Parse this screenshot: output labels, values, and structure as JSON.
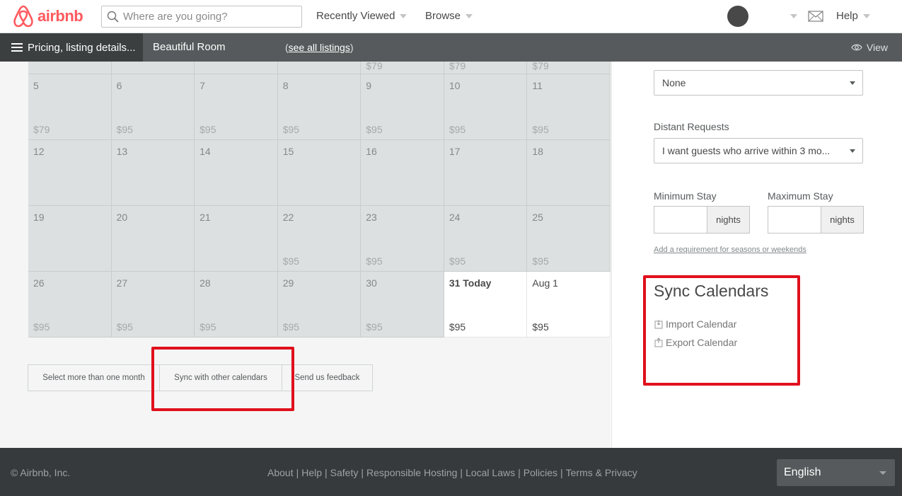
{
  "header": {
    "logo_text": "airbnb",
    "search_placeholder": "Where are you going?",
    "recently_viewed": "Recently Viewed",
    "browse": "Browse",
    "help": "Help"
  },
  "subnav": {
    "menu_label": "Pricing, listing details...",
    "listing_name": "Beautiful Room",
    "see_all_open": "(",
    "see_all": "see all listings",
    "see_all_close": ")",
    "view": "View"
  },
  "calendar": {
    "partial_row": [
      "",
      "",
      "",
      "",
      "$79",
      "$79",
      "$79"
    ],
    "weeks": [
      {
        "days": [
          "5",
          "6",
          "7",
          "8",
          "9",
          "10",
          "11"
        ],
        "prices": [
          "$79",
          "$95",
          "$95",
          "$95",
          "$95",
          "$95",
          "$95"
        ]
      },
      {
        "days": [
          "12",
          "13",
          "14",
          "15",
          "16",
          "17",
          "18"
        ],
        "prices": [
          "",
          "",
          "",
          "",
          "",
          "",
          ""
        ]
      },
      {
        "days": [
          "19",
          "20",
          "21",
          "22",
          "23",
          "24",
          "25"
        ],
        "prices": [
          "",
          "",
          "",
          "$95",
          "$95",
          "$95",
          "$95"
        ]
      },
      {
        "days": [
          "26",
          "27",
          "28",
          "29",
          "30",
          "31 Today",
          "Aug 1"
        ],
        "prices": [
          "$95",
          "$95",
          "$95",
          "$95",
          "$95",
          "$95",
          "$95"
        ]
      }
    ]
  },
  "buttons": {
    "select_month": "Select more than one month",
    "sync": "Sync with other calendars",
    "feedback": "Send us feedback"
  },
  "settings": {
    "top_select": "None",
    "distant_label": "Distant Requests",
    "distant_value": "I want guests who arrive within 3 mo...",
    "min_stay_label": "Minimum Stay",
    "max_stay_label": "Maximum Stay",
    "nights": "nights",
    "requirement_link": "Add a requirement for seasons or weekends"
  },
  "sync": {
    "title": "Sync Calendars",
    "import": "Import Calendar",
    "export": "Export Calendar"
  },
  "footer": {
    "copyright": "© Airbnb, Inc.",
    "links": [
      "About",
      "Help",
      "Safety",
      "Responsible Hosting",
      "Local Laws",
      "Policies",
      "Terms & Privacy"
    ],
    "language": "English"
  },
  "colors": {
    "brand": "#ff5a5f",
    "highlight": "#e0101c",
    "booked_cell": "#dce0e0"
  }
}
